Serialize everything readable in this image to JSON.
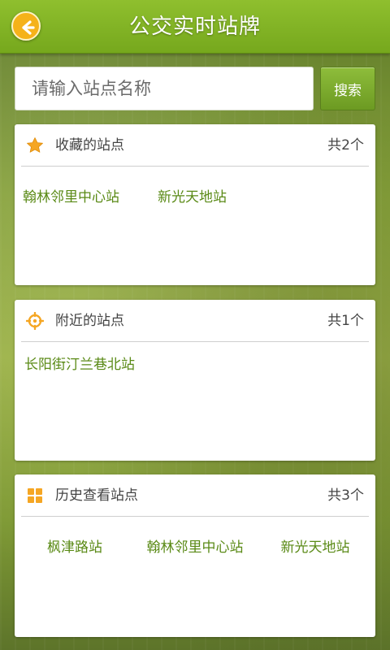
{
  "header": {
    "title": "公交实时站牌",
    "back_icon": "back-arrow-icon"
  },
  "search": {
    "placeholder": "请输入站点名称",
    "button_label": "搜索"
  },
  "favorites": {
    "title": "收藏的站点",
    "count": "共2个",
    "icon": "star-icon",
    "icon_color": "#f5a623",
    "stations": [
      "翰林邻里中心站",
      "新光天地站"
    ]
  },
  "nearby": {
    "title": "附近的站点",
    "count": "共1个",
    "icon": "locate-icon",
    "icon_color": "#f5a623",
    "stations": [
      "长阳街汀兰巷北站"
    ]
  },
  "history": {
    "title": "历史查看站点",
    "count": "共3个",
    "icon": "grid-icon",
    "icon_color": "#f5a623",
    "stations": [
      "枫津路站",
      "翰林邻里中心站",
      "新光天地站"
    ]
  },
  "colors": {
    "accent_green": "#76a81d",
    "station_text": "#5a8a16",
    "back_button": "#f5b21a"
  }
}
